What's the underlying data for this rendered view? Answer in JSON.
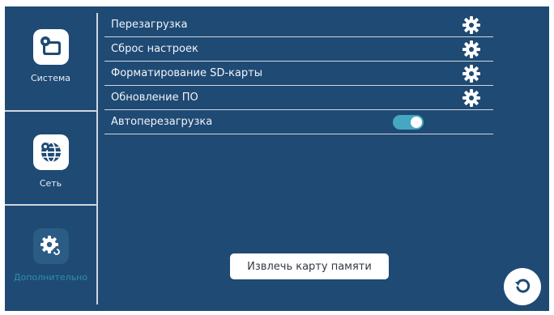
{
  "sidebar": {
    "items": [
      {
        "label": "Система",
        "icon": "system-icon"
      },
      {
        "label": "Сеть",
        "icon": "network-globe-icon"
      },
      {
        "label": "Дополнительно",
        "icon": "advanced-gear-icon"
      }
    ]
  },
  "settings": {
    "rows": [
      {
        "label": "Перезагрузка"
      },
      {
        "label": "Сброс настроек"
      },
      {
        "label": "Форматирование SD-карты"
      },
      {
        "label": "Обновление ПО"
      },
      {
        "label": "Автоперезагрузка",
        "toggle_on": true
      }
    ]
  },
  "buttons": {
    "eject_label": "Извлечь карту памяти",
    "back_icon": "back-arrow-icon"
  },
  "colors": {
    "background": "#1f4a74",
    "accent": "#46a7c0",
    "divider": "#cfd7df"
  }
}
